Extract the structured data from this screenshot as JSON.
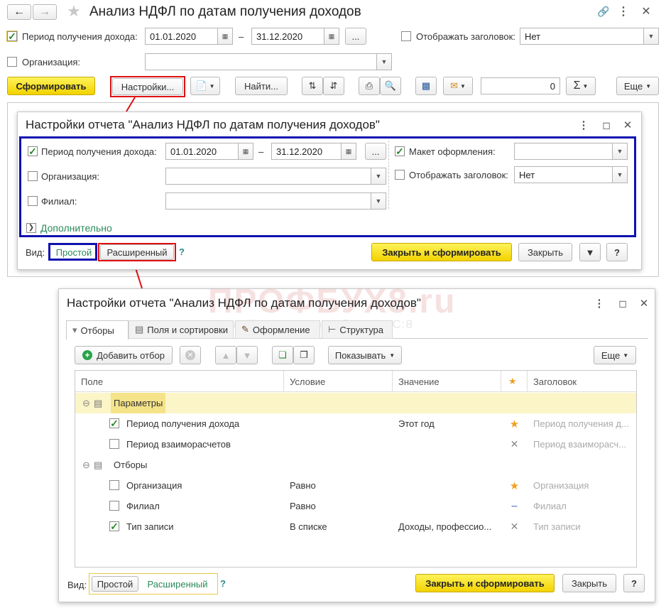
{
  "main": {
    "title": "Анализ НДФЛ по датам получения доходов",
    "period_label": "Период получения дохода:",
    "period_from": "01.01.2020",
    "period_to": "31.12.2020",
    "dash": "–",
    "dots": "...",
    "show_header_label": "Отображать заголовок:",
    "show_header_value": "Нет",
    "org_label": "Организация:",
    "org_value": "",
    "form_button": "Сформировать",
    "settings_button": "Настройки...",
    "find_button": "Найти...",
    "sum_value": "0",
    "more_button": "Еще"
  },
  "dialog1": {
    "title": "Настройки отчета \"Анализ НДФЛ по датам получения доходов\"",
    "period_label": "Период получения дохода:",
    "period_from": "01.01.2020",
    "period_to": "31.12.2020",
    "dash": "–",
    "dots": "...",
    "org_label": "Организация:",
    "branch_label": "Филиал:",
    "layout_label": "Макет оформления:",
    "layout_value": "",
    "show_header_label": "Отображать заголовок:",
    "show_header_value": "Нет",
    "additional": "Дополнительно",
    "view_label": "Вид:",
    "simple": "Простой",
    "extended": "Расширенный",
    "help": "?",
    "close_form": "Закрыть и сформировать",
    "close": "Закрыть",
    "q": "?"
  },
  "dialog2": {
    "title": "Настройки отчета \"Анализ НДФЛ по датам получения доходов\"",
    "tabs": [
      "Отборы",
      "Поля и сортировки",
      "Оформление",
      "Структура"
    ],
    "add_filter": "Добавить отбор",
    "show": "Показывать",
    "more": "Еще",
    "columns": [
      "Поле",
      "Условие",
      "Значение",
      "★",
      "Заголовок"
    ],
    "group_params": "Параметры",
    "group_filters": "Отборы",
    "rows": [
      {
        "field": "Период получения дохода",
        "condition": "",
        "value": "Этот год",
        "mark": "★",
        "header": "Период получения д..."
      },
      {
        "field": "Период взаиморасчетов",
        "condition": "",
        "value": "",
        "mark": "✕",
        "header": "Период взаиморасч..."
      },
      {
        "field": "Организация",
        "condition": "Равно",
        "value": "",
        "mark": "★",
        "header": "Организация"
      },
      {
        "field": "Филиал",
        "condition": "Равно",
        "value": "",
        "mark": "–",
        "header": "Филиал"
      },
      {
        "field": "Тип записи",
        "condition": "В списке",
        "value": "Доходы, професcио...",
        "mark": "✕",
        "header": "Тип записи"
      }
    ],
    "view_label": "Вид:",
    "simple": "Простой",
    "extended": "Расширенный",
    "help": "?",
    "close_form": "Закрыть и сформировать",
    "close": "Закрыть",
    "q": "?"
  },
  "watermark": {
    "brand": "ПРОФБУХ8.ru",
    "tagline": "Онлайн-курсы по работе в 1С:8"
  }
}
